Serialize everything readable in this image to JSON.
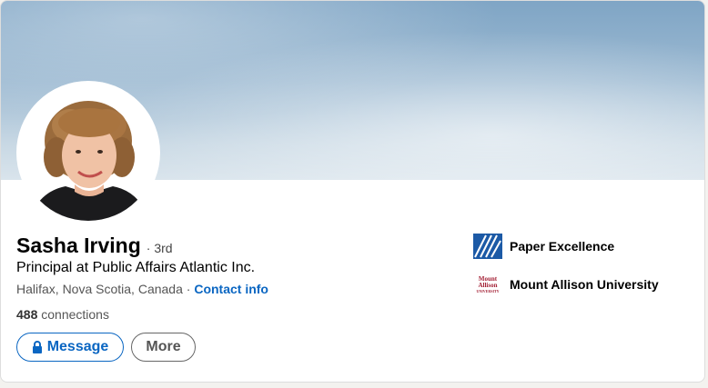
{
  "profile": {
    "name": "Sasha Irving",
    "degree": "· 3rd",
    "headline": "Principal at Public Affairs Atlantic Inc.",
    "location": "Halifax, Nova Scotia, Canada",
    "separator": "·",
    "contact_info_label": "Contact info",
    "connections_count": "488",
    "connections_label": "connections"
  },
  "actions": {
    "message_label": "Message",
    "more_label": "More"
  },
  "experience": [
    {
      "name": "Paper Excellence",
      "logo_icon": "paper-excellence-logo",
      "logo_color": "#1c5aa6"
    },
    {
      "name": "Mount Allison University",
      "logo_icon": "mount-allison-logo",
      "logo_color": "#a31f34"
    }
  ],
  "logo_text": {
    "mount_allison": [
      "Mount",
      "Allison",
      "UNIVERSITY"
    ]
  },
  "colors": {
    "accent": "#0a66c2",
    "background": "#f3f2ef"
  }
}
